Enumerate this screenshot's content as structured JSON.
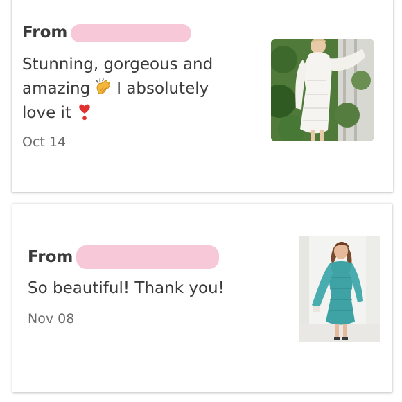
{
  "reviews": [
    {
      "from_label": "From",
      "text_parts": [
        "Stunning, gorgeous and",
        "amazing",
        "I absolutely",
        "love it"
      ],
      "date": "Oct 14",
      "emojis": [
        "clapping-hands-emoji",
        "heart-exclamation-emoji"
      ],
      "photo_desc": "white-lace-dress-photo"
    },
    {
      "from_label": "From",
      "text": "So beautiful! Thank you!",
      "date": "Nov 08",
      "photo_desc": "teal-lace-dress-photo"
    }
  ],
  "colors": {
    "redaction": "#f7c9d8",
    "text": "#3a3a3a",
    "date": "#6b6b6b",
    "teal_dress": "#3fa3a6"
  }
}
